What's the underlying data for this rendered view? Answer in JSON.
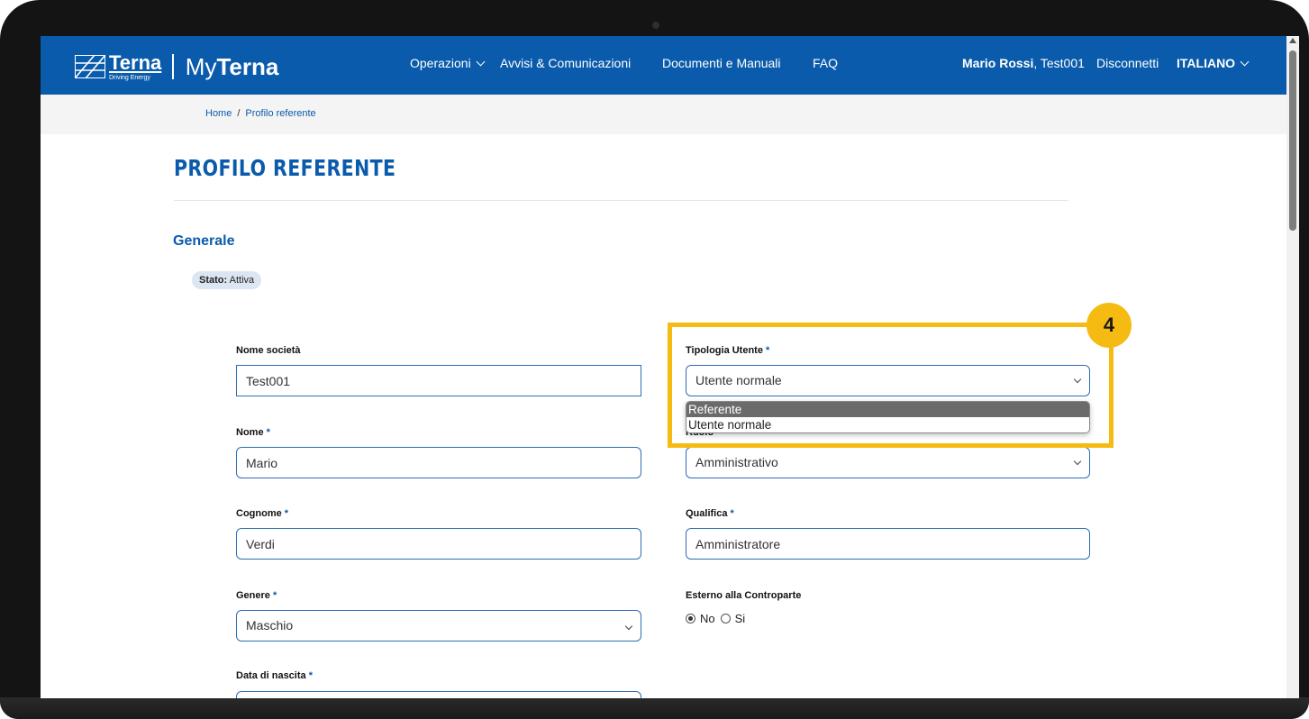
{
  "header": {
    "brand_name": "Terna",
    "brand_tagline": "Driving Energy",
    "app_name_prefix": "My",
    "app_name_bold": "Terna",
    "nav": {
      "operazioni": "Operazioni",
      "avvisi": "Avvisi & Comunicazioni",
      "documenti": "Documenti e Manuali",
      "faq": "FAQ"
    },
    "user_name": "Mario Rossi",
    "user_company": ", Test001",
    "logout": "Disconnetti",
    "language": "ITALIANO"
  },
  "breadcrumb": {
    "home": "Home",
    "separator": "/",
    "current": "Profilo referente"
  },
  "page": {
    "title": "PROFILO REFERENTE",
    "section": "Generale"
  },
  "status": {
    "label": "Stato:",
    "value": "Attiva"
  },
  "form": {
    "required_mark": "*",
    "nome_societa": {
      "label": "Nome società",
      "value": "Test001"
    },
    "tipologia_utente": {
      "label": "Tipologia Utente",
      "value": "Utente normale",
      "options": [
        "Referente",
        "Utente normale"
      ]
    },
    "nome": {
      "label": "Nome",
      "value": "Mario"
    },
    "ruolo": {
      "label": "Ruolo",
      "value": "Amministrativo"
    },
    "cognome": {
      "label": "Cognome",
      "value": "Verdi"
    },
    "qualifica": {
      "label": "Qualifica",
      "value": "Amministratore"
    },
    "genere": {
      "label": "Genere",
      "value": "Maschio"
    },
    "esterno": {
      "label": "Esterno alla Controparte",
      "option_no": "No",
      "option_si": "Si",
      "selected": "No"
    },
    "data_nascita": {
      "label": "Data di nascita"
    }
  },
  "annotation": {
    "step_number": "4",
    "color": "#f6bb12"
  },
  "colors": {
    "brand_blue": "#0a5bab",
    "highlight": "#f6bb12"
  }
}
